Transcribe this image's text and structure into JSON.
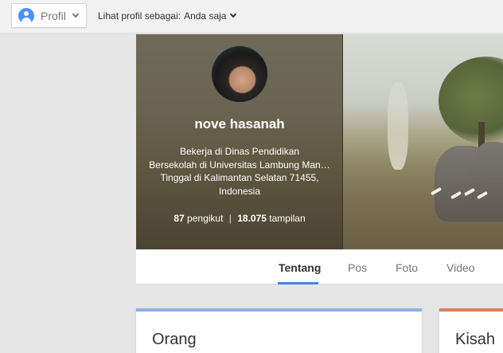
{
  "topbar": {
    "profile_button_label": "Profil",
    "view_as_label": "Lihat profil sebagai:",
    "view_as_value": "Anda saja"
  },
  "profile": {
    "name": "nove hasanah",
    "info_lines": [
      "Bekerja di Dinas Pendidikan",
      "Bersekolah di Universitas Lambung Man…",
      "Tinggal di Kalimantan Selatan 71455,",
      "Indonesia"
    ],
    "followers_count": "87",
    "followers_label": "pengikut",
    "views_count": "18.075",
    "views_label": "tampilan"
  },
  "tabs": [
    {
      "label": "Tentang",
      "active": true
    },
    {
      "label": "Pos"
    },
    {
      "label": "Foto"
    },
    {
      "label": "Video"
    }
  ],
  "cards": {
    "left_title": "Orang",
    "right_title": "Kisah"
  },
  "colors": {
    "tab_underline": "#4285f4",
    "card_left_accent": "#8fb0e8",
    "card_right_accent": "#d9825b",
    "profile_icon": "#4d90fe"
  },
  "icons": {
    "profile": "person-circle-icon",
    "dropdown": "chevron-down-icon"
  }
}
